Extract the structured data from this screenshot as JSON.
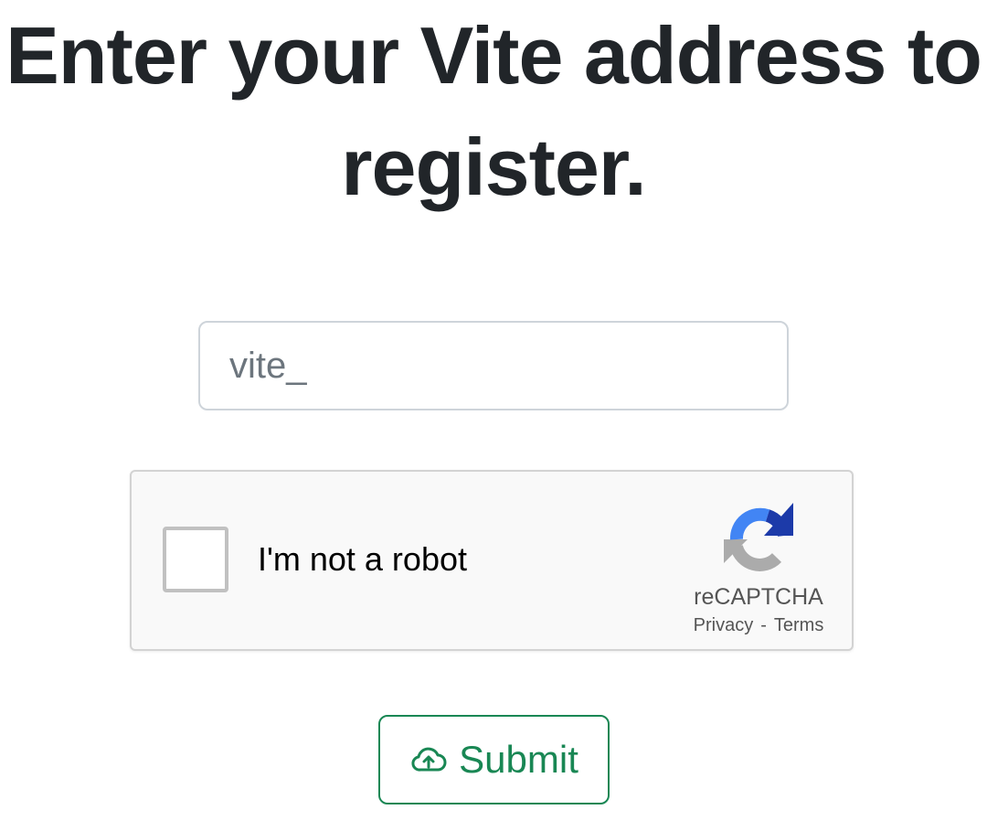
{
  "heading": {
    "line1": "Enter your Vite address to",
    "line2": "register."
  },
  "address_input": {
    "placeholder": "vite_",
    "value": ""
  },
  "recaptcha": {
    "label": "I'm not a robot",
    "brand": "reCAPTCHA",
    "privacy_link": "Privacy",
    "separator": "-",
    "terms_link": "Terms",
    "logo_icon": "recaptcha-logo-icon",
    "colors": {
      "blue_dark": "#1c3aa9",
      "blue_light": "#4285f4",
      "gray": "#ababab"
    }
  },
  "submit": {
    "label": "Submit",
    "icon": "cloud-upload-icon",
    "color": "#198754"
  }
}
